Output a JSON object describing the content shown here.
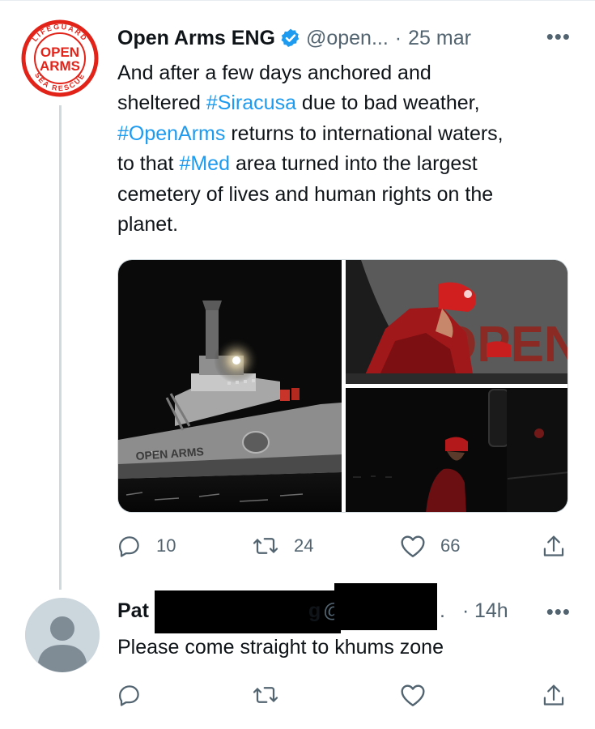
{
  "tweet": {
    "display_name": "Open Arms ENG",
    "handle": "@open...",
    "separator": "·",
    "date": "25 mar",
    "more_label": "•••",
    "avatar_logo": {
      "ring_top": "LIFEGUARD",
      "ring_bottom": "SEA RESCUE",
      "word1": "OPEN",
      "word2": "ARMS"
    },
    "text_lines": [
      [
        {
          "t": "And after a few days anchored and",
          "tag": false
        }
      ],
      [
        {
          "t": "sheltered ",
          "tag": false
        },
        {
          "t": "#Siracusa",
          "tag": true
        },
        {
          "t": " due to bad weather,",
          "tag": false
        }
      ],
      [
        {
          "t": "#OpenArms",
          "tag": true
        },
        {
          "t": " returns to international waters,",
          "tag": false
        }
      ],
      [
        {
          "t": "to that ",
          "tag": false
        },
        {
          "t": "#Med",
          "tag": true
        },
        {
          "t": " area turned into the largest",
          "tag": false
        }
      ],
      [
        {
          "t": "cemetery of lives and human rights on the",
          "tag": false
        }
      ],
      [
        {
          "t": "planet.",
          "tag": false
        }
      ]
    ],
    "media": {
      "image1_label": "OPEN ARMS",
      "image2_label": "OPEN"
    },
    "actions": {
      "reply_count": "10",
      "retweet_count": "24",
      "like_count": "66"
    }
  },
  "reply": {
    "name_visible_prefix": "Pat",
    "name_visible_suffix": "g",
    "handle_visible_prefix": "@",
    "handle_visible_suffix": ".",
    "separator": "·",
    "time": "14h",
    "more_label": "•••",
    "text": "Please come straight to khums zone"
  },
  "colors": {
    "link": "#1d9bf0",
    "muted": "#536471",
    "verified": "#1d9bf0",
    "brand_red": "#e2231a",
    "thread_line": "#cfd9de"
  }
}
